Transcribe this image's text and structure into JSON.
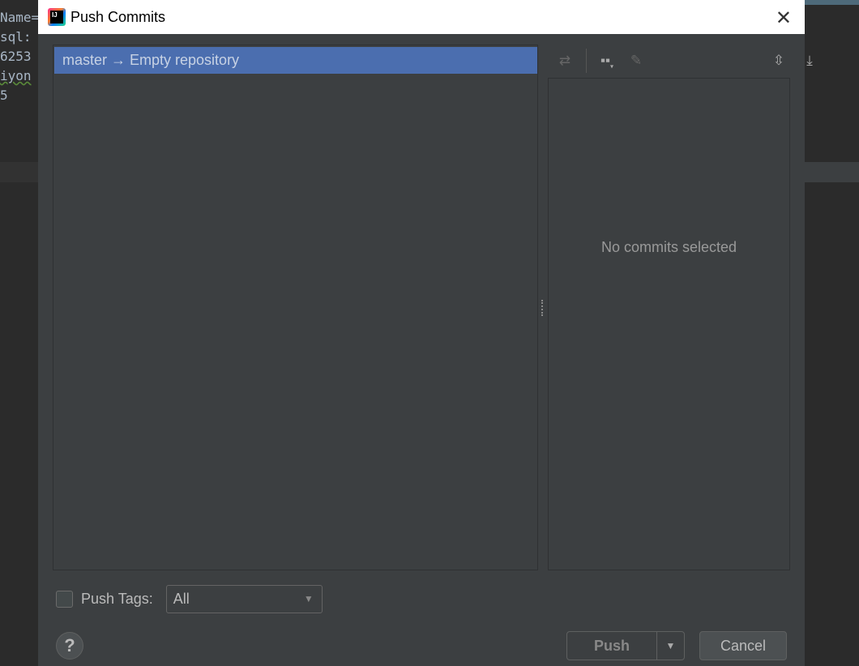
{
  "background_editor": {
    "lines": [
      "Name=",
      "sql:",
      "6253",
      "iyon",
      "5"
    ]
  },
  "dialog": {
    "title": "Push Commits",
    "repo_row": "master → Empty repository",
    "details_empty": "No commits selected",
    "toolbar": [
      "merge-icon",
      "group-by-icon",
      "edit-icon",
      "expand-all-icon",
      "collapse-all-icon"
    ],
    "push_tags_label": "Push Tags:",
    "push_tags_checked": false,
    "push_tags_value": "All",
    "help_label": "?",
    "push_label": "Push",
    "cancel_label": "Cancel"
  },
  "colors": {
    "selection": "#4b6eaf",
    "dialog_bg": "#3c3f41"
  }
}
